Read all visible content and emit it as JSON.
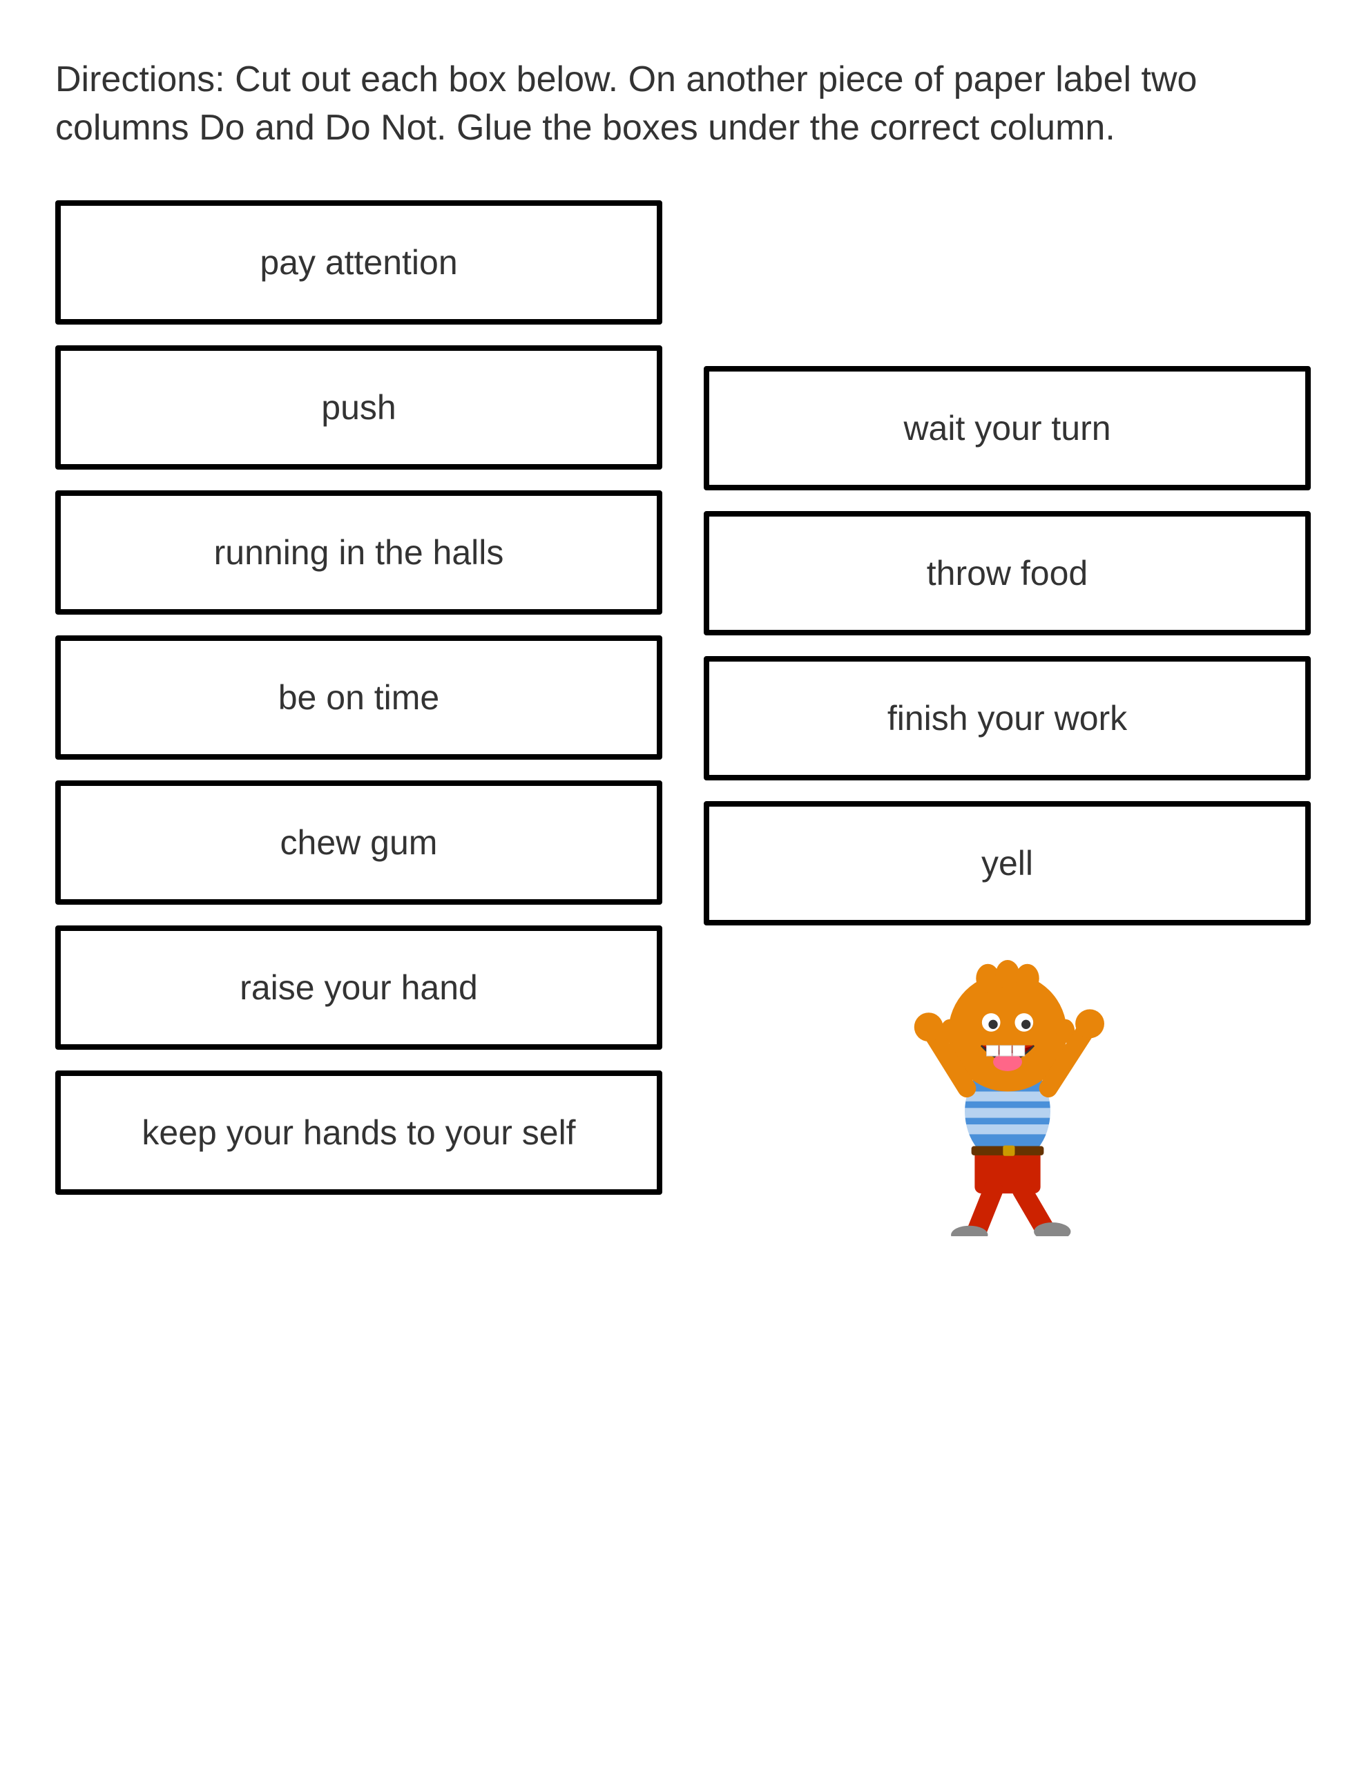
{
  "directions": {
    "text": "Directions: Cut out each box below. On another piece of paper label two columns Do and Do Not. Glue the boxes under the correct column."
  },
  "left_column": {
    "cards": [
      {
        "id": "pay-attention",
        "label": "pay attention"
      },
      {
        "id": "push",
        "label": "push"
      },
      {
        "id": "running-in-halls",
        "label": "running in the halls"
      },
      {
        "id": "be-on-time",
        "label": "be on time"
      },
      {
        "id": "chew-gum",
        "label": "chew gum"
      },
      {
        "id": "raise-your-hand",
        "label": "raise your hand"
      },
      {
        "id": "keep-hands",
        "label": "keep your hands to your self"
      }
    ]
  },
  "right_column": {
    "cards": [
      {
        "id": "wait-your-turn",
        "label": "wait your turn"
      },
      {
        "id": "throw-food",
        "label": "throw food"
      },
      {
        "id": "finish-your-work",
        "label": "finish your work"
      },
      {
        "id": "yell",
        "label": "yell"
      }
    ]
  }
}
